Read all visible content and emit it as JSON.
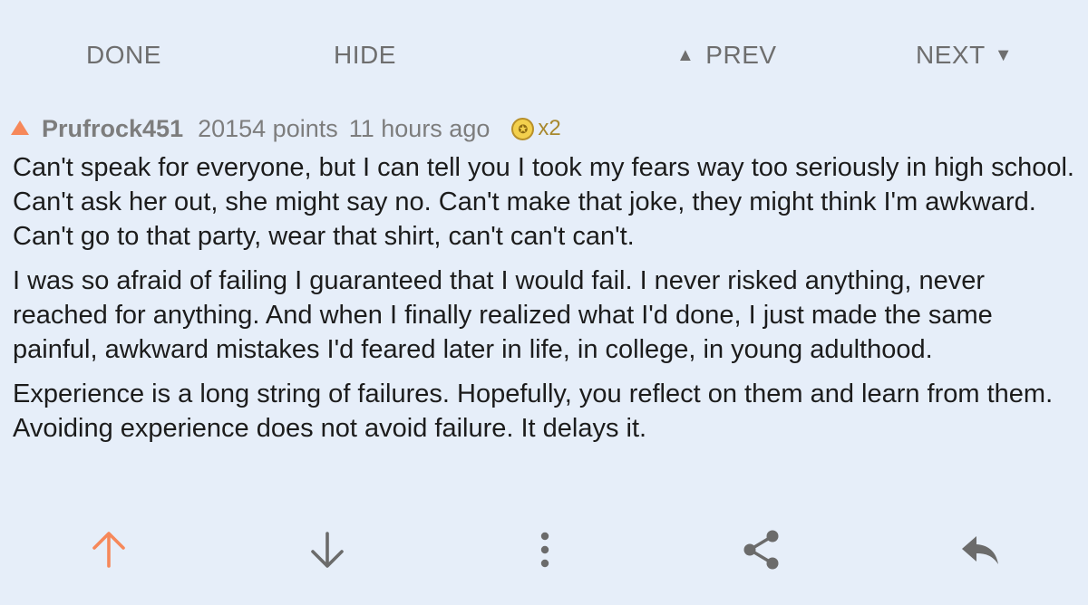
{
  "nav": {
    "done_label": "DONE",
    "hide_label": "HIDE",
    "prev_label": "PREV",
    "next_label": "NEXT",
    "prev_icon": "triangle-up",
    "next_icon": "triangle-down"
  },
  "comment": {
    "author": "Prufrock451",
    "points": "20154 points",
    "age": "11 hours ago",
    "gild_count": "x2",
    "paragraphs": [
      "Can't speak for everyone, but I can tell you I took my fears way too seriously in high school. Can't ask her out, she might say no. Can't make that joke, they might think I'm awkward. Can't go to that party, wear that shirt, can't can't can't.",
      "I was so afraid of failing I guaranteed that I would fail. I never risked anything, never reached for anything. And when I finally realized what I'd done, I just made the same painful, awkward mistakes I'd feared later in life, in college, in young adulthood.",
      "Experience is a long string of failures. Hopefully, you reflect on them and learn from them. Avoiding experience does not avoid failure. It delays it."
    ]
  },
  "actions": [
    "upvote-icon",
    "downvote-icon",
    "more-options-icon",
    "share-icon",
    "reply-icon"
  ],
  "colors": {
    "background": "#e6eef9",
    "upvote_accent": "#f6885a",
    "muted_text": "#7d7d7d",
    "icon_gray": "#6b6b6b",
    "gold": "#f3d04d"
  }
}
